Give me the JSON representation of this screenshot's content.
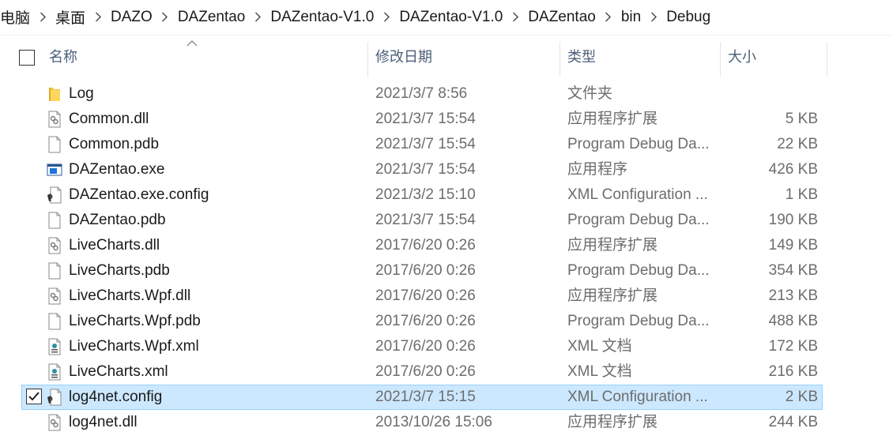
{
  "breadcrumb": {
    "items": [
      "电脑",
      "桌面",
      "DAZO",
      "DAZentao",
      "DAZentao-V1.0",
      "DAZentao-V1.0",
      "DAZentao",
      "bin",
      "Debug"
    ],
    "separator_icon": "chevron-right-icon"
  },
  "columns": {
    "name": "名称",
    "date": "修改日期",
    "type": "类型",
    "size": "大小",
    "sort_icon": "sort-ascending-icon"
  },
  "files": [
    {
      "name": "Log",
      "date": "2021/3/7 8:56",
      "type": "文件夹",
      "size": "",
      "icon": "folder-icon",
      "selected": false
    },
    {
      "name": "Common.dll",
      "date": "2021/3/7 15:54",
      "type": "应用程序扩展",
      "size": "5 KB",
      "icon": "dll-file-icon",
      "selected": false
    },
    {
      "name": "Common.pdb",
      "date": "2021/3/7 15:54",
      "type": "Program Debug Da...",
      "size": "22 KB",
      "icon": "blank-file-icon",
      "selected": false
    },
    {
      "name": "DAZentao.exe",
      "date": "2021/3/7 15:54",
      "type": "应用程序",
      "size": "426 KB",
      "icon": "exe-file-icon",
      "selected": false
    },
    {
      "name": "DAZentao.exe.config",
      "date": "2021/3/2 15:10",
      "type": "XML Configuration ...",
      "size": "1 KB",
      "icon": "config-file-icon",
      "selected": false
    },
    {
      "name": "DAZentao.pdb",
      "date": "2021/3/7 15:54",
      "type": "Program Debug Da...",
      "size": "190 KB",
      "icon": "blank-file-icon",
      "selected": false
    },
    {
      "name": "LiveCharts.dll",
      "date": "2017/6/20 0:26",
      "type": "应用程序扩展",
      "size": "149 KB",
      "icon": "dll-file-icon",
      "selected": false
    },
    {
      "name": "LiveCharts.pdb",
      "date": "2017/6/20 0:26",
      "type": "Program Debug Da...",
      "size": "354 KB",
      "icon": "blank-file-icon",
      "selected": false
    },
    {
      "name": "LiveCharts.Wpf.dll",
      "date": "2017/6/20 0:26",
      "type": "应用程序扩展",
      "size": "213 KB",
      "icon": "dll-file-icon",
      "selected": false
    },
    {
      "name": "LiveCharts.Wpf.pdb",
      "date": "2017/6/20 0:26",
      "type": "Program Debug Da...",
      "size": "488 KB",
      "icon": "blank-file-icon",
      "selected": false
    },
    {
      "name": "LiveCharts.Wpf.xml",
      "date": "2017/6/20 0:26",
      "type": "XML 文档",
      "size": "172 KB",
      "icon": "xml-file-icon",
      "selected": false
    },
    {
      "name": "LiveCharts.xml",
      "date": "2017/6/20 0:26",
      "type": "XML 文档",
      "size": "216 KB",
      "icon": "xml-file-icon",
      "selected": false
    },
    {
      "name": "log4net.config",
      "date": "2021/3/7 15:15",
      "type": "XML Configuration ...",
      "size": "2 KB",
      "icon": "config-file-icon",
      "selected": true
    },
    {
      "name": "log4net.dll",
      "date": "2013/10/26 15:06",
      "type": "应用程序扩展",
      "size": "244 KB",
      "icon": "dll-file-icon",
      "selected": false
    }
  ],
  "colors": {
    "selection_bg": "#cce8ff",
    "selection_border": "#99d1ff",
    "header_text": "#4c607a",
    "folder": "#f4c23d"
  }
}
